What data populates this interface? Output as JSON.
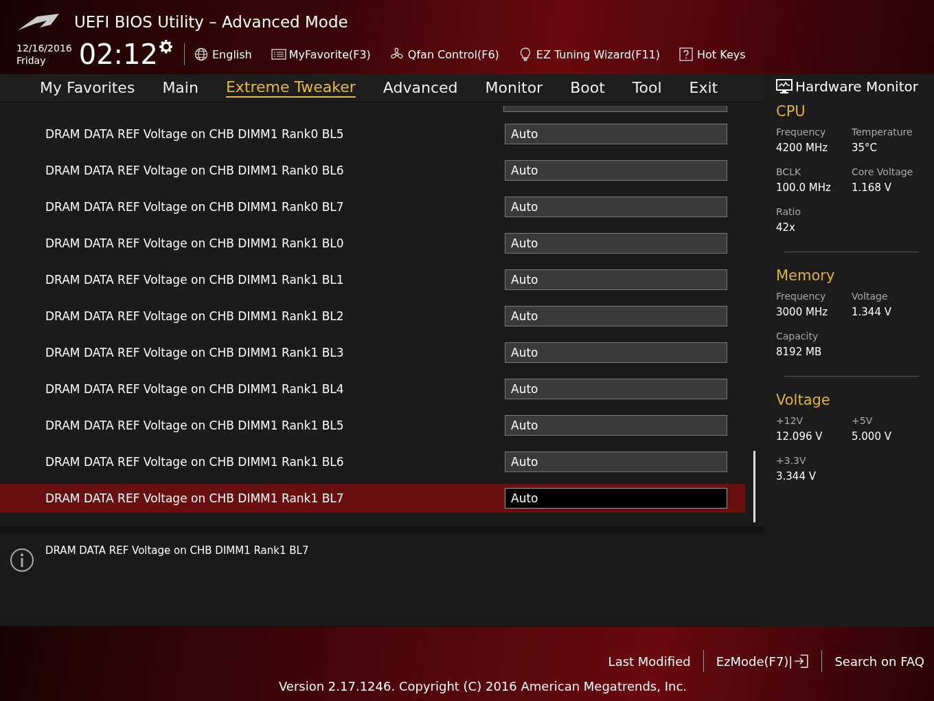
{
  "window": {
    "title": "UEFI BIOS Utility – Advanced Mode"
  },
  "header": {
    "date": "12/16/2016",
    "day": "Friday",
    "time": "02:12",
    "tools": [
      {
        "kind": "globe",
        "label": "English"
      },
      {
        "kind": "list",
        "label": "MyFavorite(F3)"
      },
      {
        "kind": "fan",
        "label": "Qfan Control(F6)"
      },
      {
        "kind": "bulb",
        "label": "EZ Tuning Wizard(F11)"
      },
      {
        "kind": "help",
        "label": "Hot Keys"
      }
    ]
  },
  "tabs": [
    {
      "label": "My Favorites",
      "selected": false
    },
    {
      "label": "Main",
      "selected": false
    },
    {
      "label": "Extreme Tweaker",
      "selected": true
    },
    {
      "label": "Advanced",
      "selected": false
    },
    {
      "label": "Monitor",
      "selected": false
    },
    {
      "label": "Boot",
      "selected": false
    },
    {
      "label": "Tool",
      "selected": false
    },
    {
      "label": "Exit",
      "selected": false
    }
  ],
  "settings": [
    {
      "label": "DRAM DATA REF Voltage on CHB DIMM1 Rank0 BL5",
      "value": "Auto",
      "selected": false
    },
    {
      "label": "DRAM DATA REF Voltage on CHB DIMM1 Rank0 BL6",
      "value": "Auto",
      "selected": false
    },
    {
      "label": "DRAM DATA REF Voltage on CHB DIMM1 Rank0 BL7",
      "value": "Auto",
      "selected": false
    },
    {
      "label": "DRAM DATA REF Voltage on CHB DIMM1 Rank1 BL0",
      "value": "Auto",
      "selected": false
    },
    {
      "label": "DRAM DATA REF Voltage on CHB DIMM1 Rank1 BL1",
      "value": "Auto",
      "selected": false
    },
    {
      "label": "DRAM DATA REF Voltage on CHB DIMM1 Rank1 BL2",
      "value": "Auto",
      "selected": false
    },
    {
      "label": "DRAM DATA REF Voltage on CHB DIMM1 Rank1 BL3",
      "value": "Auto",
      "selected": false
    },
    {
      "label": "DRAM DATA REF Voltage on CHB DIMM1 Rank1 BL4",
      "value": "Auto",
      "selected": false
    },
    {
      "label": "DRAM DATA REF Voltage on CHB DIMM1 Rank1 BL5",
      "value": "Auto",
      "selected": false
    },
    {
      "label": "DRAM DATA REF Voltage on CHB DIMM1 Rank1 BL6",
      "value": "Auto",
      "selected": false
    },
    {
      "label": "DRAM DATA REF Voltage on CHB DIMM1 Rank1 BL7",
      "value": "Auto",
      "selected": true
    }
  ],
  "help_text": "DRAM DATA REF Voltage on CHB DIMM1 Rank1 BL7",
  "hardware_monitor": {
    "title": "Hardware Monitor",
    "sections": [
      {
        "title": "CPU",
        "items": [
          {
            "label": "Frequency",
            "value": "4200 MHz"
          },
          {
            "label": "Temperature",
            "value": "35°C"
          },
          {
            "label": "BCLK",
            "value": "100.0 MHz"
          },
          {
            "label": "Core Voltage",
            "value": "1.168 V"
          },
          {
            "label": "Ratio",
            "value": "42x"
          }
        ]
      },
      {
        "title": "Memory",
        "items": [
          {
            "label": "Frequency",
            "value": "3000 MHz"
          },
          {
            "label": "Voltage",
            "value": "1.344 V"
          },
          {
            "label": "Capacity",
            "value": "8192 MB"
          }
        ]
      },
      {
        "title": "Voltage",
        "items": [
          {
            "label": "+12V",
            "value": "12.096 V"
          },
          {
            "label": "+5V",
            "value": "5.000 V"
          },
          {
            "label": "+3.3V",
            "value": "3.344 V"
          }
        ]
      }
    ]
  },
  "footer": {
    "links": [
      {
        "label": "Last Modified",
        "icon": false
      },
      {
        "label": "EzMode(F7)|",
        "icon": true
      },
      {
        "label": "Search on FAQ",
        "icon": false
      }
    ],
    "version": "Version 2.17.1246. Copyright (C) 2016 American Megatrends, Inc."
  }
}
